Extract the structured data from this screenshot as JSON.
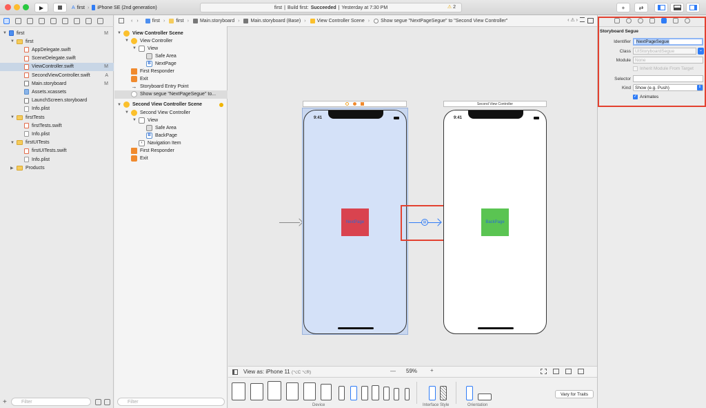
{
  "toolbar": {
    "scheme_name": "first",
    "destination": "iPhone SE (2nd generation)",
    "activity_project": "first",
    "activity_status_prefix": "Build first:",
    "activity_status": "Succeeded",
    "activity_time": "Yesterday at 7:30 PM",
    "warning_count": "2",
    "add_symbol": "+",
    "swap_symbol": "⇄"
  },
  "navigator": {
    "items": [
      {
        "label": "first",
        "badge": "M",
        "type": "proj",
        "indent": 0,
        "disc": "▼"
      },
      {
        "label": "first",
        "badge": "",
        "type": "folder",
        "indent": 1,
        "disc": "▼"
      },
      {
        "label": "AppDelegate.swift",
        "badge": "",
        "type": "swift",
        "indent": 2,
        "disc": ""
      },
      {
        "label": "SceneDelegate.swift",
        "badge": "",
        "type": "swift",
        "indent": 2,
        "disc": ""
      },
      {
        "label": "ViewController.swift",
        "badge": "M",
        "type": "swift",
        "indent": 2,
        "disc": "",
        "selected": true
      },
      {
        "label": "SecondViewController.swift",
        "badge": "A",
        "type": "swift",
        "indent": 2,
        "disc": ""
      },
      {
        "label": "Main.storyboard",
        "badge": "M",
        "type": "sb",
        "indent": 2,
        "disc": ""
      },
      {
        "label": "Assets.xcassets",
        "badge": "",
        "type": "xc",
        "indent": 2,
        "disc": ""
      },
      {
        "label": "LaunchScreen.storyboard",
        "badge": "",
        "type": "sb",
        "indent": 2,
        "disc": ""
      },
      {
        "label": "Info.plist",
        "badge": "",
        "type": "plist",
        "indent": 2,
        "disc": ""
      },
      {
        "label": "firstTests",
        "badge": "",
        "type": "folder",
        "indent": 1,
        "disc": "▼"
      },
      {
        "label": "firstTests.swift",
        "badge": "",
        "type": "swift",
        "indent": 2,
        "disc": ""
      },
      {
        "label": "Info.plist",
        "badge": "",
        "type": "plist",
        "indent": 2,
        "disc": ""
      },
      {
        "label": "firstUITests",
        "badge": "",
        "type": "folder",
        "indent": 1,
        "disc": "▼"
      },
      {
        "label": "firstUITests.swift",
        "badge": "",
        "type": "swift",
        "indent": 2,
        "disc": ""
      },
      {
        "label": "Info.plist",
        "badge": "",
        "type": "plist",
        "indent": 2,
        "disc": ""
      },
      {
        "label": "Products",
        "badge": "",
        "type": "folder",
        "indent": 1,
        "disc": "▶"
      }
    ],
    "filter_placeholder": "Filter",
    "add_symbol": "+"
  },
  "jumpbar": {
    "crumbs": [
      "first",
      "first",
      "Main.storyboard",
      "Main.storyboard (Base)",
      "View Controller Scene",
      "Show segue \"NextPageSegue\" to \"Second View Controller\""
    ]
  },
  "outline": {
    "items": [
      {
        "label": "View Controller Scene",
        "type": "vc",
        "indent": 0,
        "disc": "▼",
        "bold": true
      },
      {
        "label": "View Controller",
        "type": "vc",
        "indent": 1,
        "disc": "▼"
      },
      {
        "label": "View",
        "type": "view",
        "indent": 2,
        "disc": "▼"
      },
      {
        "label": "Safe Area",
        "type": "safe",
        "indent": 3,
        "disc": ""
      },
      {
        "label": "NextPage",
        "type": "btn",
        "indent": 3,
        "disc": ""
      },
      {
        "label": "First Responder",
        "type": "fr",
        "indent": 1,
        "disc": ""
      },
      {
        "label": "Exit",
        "type": "exit",
        "indent": 1,
        "disc": ""
      },
      {
        "label": "Storyboard Entry Point",
        "type": "arrow",
        "indent": 1,
        "disc": ""
      },
      {
        "label": "Show segue \"NextPageSegue\" to...",
        "type": "seg",
        "indent": 1,
        "disc": "",
        "selected": true
      },
      {
        "label": "Second View Controller Scene",
        "type": "vc",
        "indent": 0,
        "disc": "▼",
        "bold": true,
        "gap": true
      },
      {
        "label": "Second View Controller",
        "type": "vc",
        "indent": 1,
        "disc": "▼"
      },
      {
        "label": "View",
        "type": "view",
        "indent": 2,
        "disc": "▼"
      },
      {
        "label": "Safe Area",
        "type": "safe",
        "indent": 3,
        "disc": ""
      },
      {
        "label": "BackPage",
        "type": "btn",
        "indent": 3,
        "disc": ""
      },
      {
        "label": "Navigation Item",
        "type": "navitem",
        "indent": 2,
        "disc": ""
      },
      {
        "label": "First Responder",
        "type": "fr",
        "indent": 1,
        "disc": ""
      },
      {
        "label": "Exit",
        "type": "exit",
        "indent": 1,
        "disc": ""
      }
    ],
    "filter_placeholder": "Filter"
  },
  "canvas": {
    "phone1_time": "9:41",
    "phone1_button": "NextPage",
    "phone2_time": "9:41",
    "phone2_button": "BackPage",
    "scene2_title": "Second View Controller",
    "button1_color": "#d9434f",
    "button2_color": "#5ac452",
    "selected_bg": "#d4e1f8"
  },
  "bottom": {
    "view_as": "View as: iPhone 11",
    "view_as_shortcut": "(⌥C ⌥R)",
    "zoom_out": "—",
    "zoom": "59%",
    "zoom_in": "+",
    "device_label": "Device",
    "style_label": "Interface Style",
    "orientation_label": "Orientation",
    "vary_button": "Vary for Traits"
  },
  "inspector": {
    "section_title": "Storyboard Segue",
    "identifier_label": "Identifier",
    "identifier_value": "NextPageSegue",
    "class_label": "Class",
    "class_placeholder": "UIStoryboardSegue",
    "module_label": "Module",
    "module_placeholder": "None",
    "inherit_label": "Inherit Module From Target",
    "selector_label": "Selector",
    "kind_label": "Kind",
    "kind_value": "Show (e.g. Push)",
    "animates_label": "Animates",
    "animates_checked": true,
    "accent": "#2f7cf6",
    "highlight": "#e3412f"
  }
}
